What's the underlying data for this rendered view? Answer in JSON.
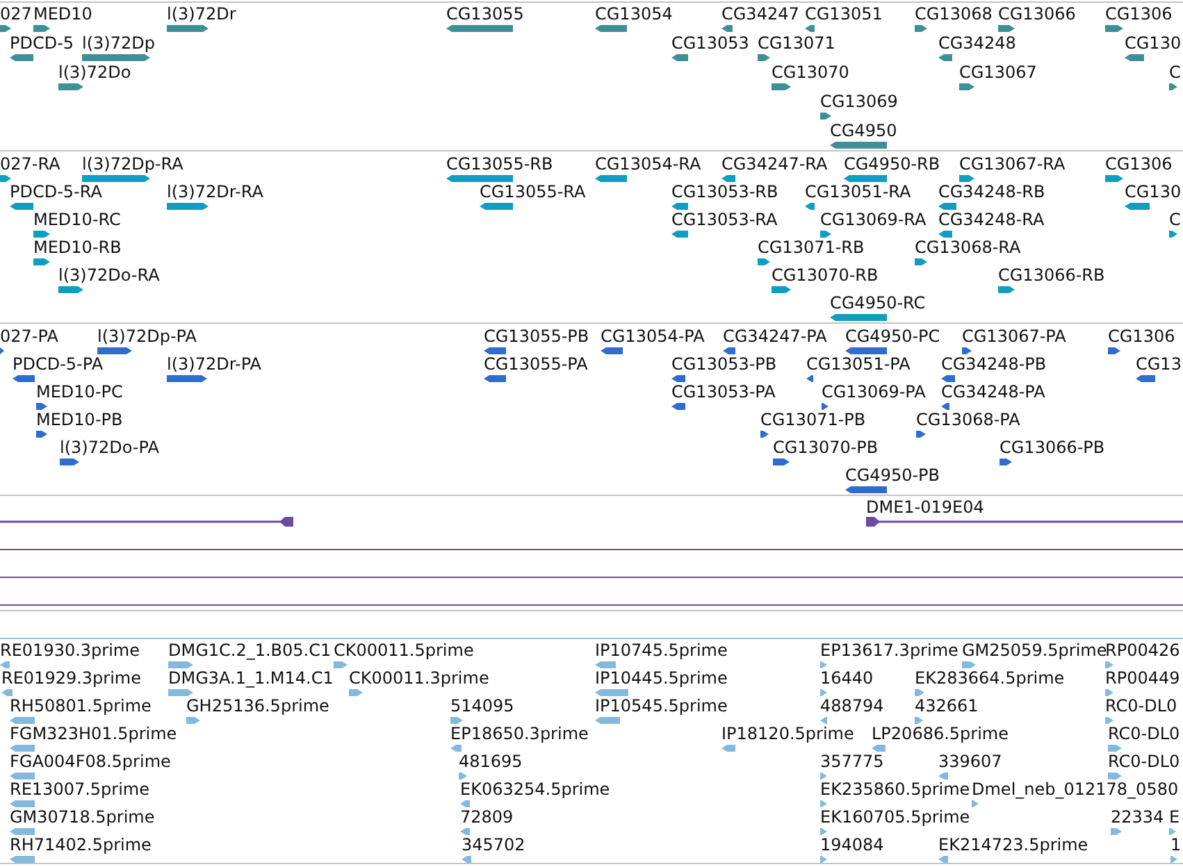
{
  "tracks": [
    {
      "kind": "gene",
      "color": "#3f8f96",
      "features": [
        {
          "label": "027",
          "reverse": false
        },
        {
          "label": "MED10",
          "reverse": false
        },
        {
          "label": "l(3)72Dr",
          "reverse": false
        },
        {
          "label": "CG13055",
          "reverse": true
        },
        {
          "label": "CG13054",
          "reverse": true
        },
        {
          "label": "CG34247",
          "reverse": true
        },
        {
          "label": "CG13051",
          "reverse": true
        },
        {
          "label": "CG13068",
          "reverse": false
        },
        {
          "label": "CG13066",
          "reverse": false
        },
        {
          "label": "CG1306",
          "reverse": false
        },
        {
          "label": "PDCD-5",
          "reverse": true
        },
        {
          "label": "l(3)72Dp",
          "reverse": false
        },
        {
          "label": "CG13053",
          "reverse": true
        },
        {
          "label": "CG13071",
          "reverse": false
        },
        {
          "label": "CG34248",
          "reverse": true
        },
        {
          "label": "CG130",
          "reverse": true
        },
        {
          "label": "l(3)72Do",
          "reverse": false
        },
        {
          "label": "CG13070",
          "reverse": false
        },
        {
          "label": "CG13067",
          "reverse": false
        },
        {
          "label": "C",
          "reverse": false
        },
        {
          "label": "CG13069",
          "reverse": false
        },
        {
          "label": "CG4950",
          "reverse": true
        }
      ]
    },
    {
      "kind": "transcript",
      "color": "#0f9dc0",
      "features": [
        {
          "label": "027-RA",
          "reverse": false
        },
        {
          "label": "l(3)72Dp-RA",
          "reverse": false
        },
        {
          "label": "CG13055-RB",
          "reverse": true
        },
        {
          "label": "CG13054-RA",
          "reverse": true
        },
        {
          "label": "CG34247-RA",
          "reverse": true
        },
        {
          "label": "CG4950-RB",
          "reverse": true
        },
        {
          "label": "CG13067-RA",
          "reverse": false
        },
        {
          "label": "CG1306",
          "reverse": false
        },
        {
          "label": "PDCD-5-RA",
          "reverse": true
        },
        {
          "label": "l(3)72Dr-RA",
          "reverse": false
        },
        {
          "label": "CG13055-RA",
          "reverse": true
        },
        {
          "label": "CG13053-RB",
          "reverse": true
        },
        {
          "label": "CG13051-RA",
          "reverse": true
        },
        {
          "label": "CG34248-RB",
          "reverse": true
        },
        {
          "label": "CG130",
          "reverse": true
        },
        {
          "label": "MED10-RC",
          "reverse": false
        },
        {
          "label": "CG13053-RA",
          "reverse": true
        },
        {
          "label": "CG13069-RA",
          "reverse": false
        },
        {
          "label": "CG34248-RA",
          "reverse": true
        },
        {
          "label": "C",
          "reverse": false
        },
        {
          "label": "MED10-RB",
          "reverse": false
        },
        {
          "label": "CG13071-RB",
          "reverse": false
        },
        {
          "label": "CG13068-RA",
          "reverse": false
        },
        {
          "label": "l(3)72Do-RA",
          "reverse": false
        },
        {
          "label": "CG13070-RB",
          "reverse": false
        },
        {
          "label": "CG13066-RB",
          "reverse": false
        },
        {
          "label": "CG4950-RC",
          "reverse": true
        }
      ]
    },
    {
      "kind": "protein",
      "color": "#2f6ccd",
      "features": [
        {
          "label": "027-PA",
          "reverse": false
        },
        {
          "label": "l(3)72Dp-PA",
          "reverse": false
        },
        {
          "label": "CG13055-PB",
          "reverse": true
        },
        {
          "label": "CG13054-PA",
          "reverse": true
        },
        {
          "label": "CG34247-PA",
          "reverse": true
        },
        {
          "label": "CG4950-PC",
          "reverse": true
        },
        {
          "label": "CG13067-PA",
          "reverse": false
        },
        {
          "label": "CG1306",
          "reverse": false
        },
        {
          "label": "PDCD-5-PA",
          "reverse": true
        },
        {
          "label": "l(3)72Dr-PA",
          "reverse": false
        },
        {
          "label": "CG13055-PA",
          "reverse": true
        },
        {
          "label": "CG13053-PB",
          "reverse": true
        },
        {
          "label": "CG13051-PA",
          "reverse": true
        },
        {
          "label": "CG34248-PB",
          "reverse": true
        },
        {
          "label": "CG13",
          "reverse": true
        },
        {
          "label": "MED10-PC",
          "reverse": false
        },
        {
          "label": "CG13053-PA",
          "reverse": true
        },
        {
          "label": "CG13069-PA",
          "reverse": false
        },
        {
          "label": "CG34248-PA",
          "reverse": true
        },
        {
          "label": "MED10-PB",
          "reverse": false
        },
        {
          "label": "CG13071-PB",
          "reverse": false
        },
        {
          "label": "CG13068-PA",
          "reverse": false
        },
        {
          "label": "l(3)72Do-PA",
          "reverse": false
        },
        {
          "label": "CG13070-PB",
          "reverse": false
        },
        {
          "label": "CG13066-PB",
          "reverse": false
        },
        {
          "label": "CG4950-PB",
          "reverse": true
        }
      ]
    },
    {
      "kind": "clone",
      "color": "#6a4ca0",
      "features": [
        {
          "reverse": true
        },
        {
          "label": "DME1-019E04",
          "reverse": false
        }
      ]
    },
    {
      "kind": "est",
      "color": "#84b9df",
      "features": [
        {
          "label": "RE01930.3prime",
          "reverse": true
        },
        {
          "label": "RE01929.3prime",
          "reverse": true
        },
        {
          "label": "RH50801.5prime",
          "reverse": true
        },
        {
          "label": "FGM323H01.5prime",
          "reverse": true
        },
        {
          "label": "FGA004F08.5prime",
          "reverse": true
        },
        {
          "label": "RE13007.5prime",
          "reverse": true
        },
        {
          "label": "GM30718.5prime",
          "reverse": true
        },
        {
          "label": "RH71402.5prime",
          "reverse": true
        },
        {
          "label": "DMG1C.2_1.B05.C1",
          "reverse": false
        },
        {
          "label": "DMG3A.1_1.M14.C1",
          "reverse": false
        },
        {
          "label": "GH25136.5prime",
          "reverse": false
        },
        {
          "label": "CK00011.5prime",
          "reverse": false
        },
        {
          "label": "CK00011.3prime",
          "reverse": false
        },
        {
          "label": "514095",
          "reverse": false
        },
        {
          "label": "EP18650.3prime",
          "reverse": true
        },
        {
          "label": "481695",
          "reverse": false
        },
        {
          "label": "EK063254.5prime",
          "reverse": true
        },
        {
          "label": "72809",
          "reverse": true
        },
        {
          "label": "345702",
          "reverse": true
        },
        {
          "label": "IP10745.5prime",
          "reverse": true
        },
        {
          "label": "IP10445.5prime",
          "reverse": true
        },
        {
          "label": "IP10545.5prime",
          "reverse": true
        },
        {
          "label": "IP18120.5prime",
          "reverse": true
        },
        {
          "label": "EP13617.3prime",
          "reverse": false
        },
        {
          "label": "16440",
          "reverse": false
        },
        {
          "label": "488794",
          "reverse": true
        },
        {
          "label": "357775",
          "reverse": false
        },
        {
          "label": "EK235860.5prime",
          "reverse": false
        },
        {
          "label": "EK160705.5prime",
          "reverse": false
        },
        {
          "label": "194084",
          "reverse": false
        },
        {
          "label": "GM25059.5prime",
          "reverse": false
        },
        {
          "label": "EK283664.5prime",
          "reverse": false
        },
        {
          "label": "432661",
          "reverse": false
        },
        {
          "label": "LP20686.5prime",
          "reverse": true
        },
        {
          "label": "339607",
          "reverse": true
        },
        {
          "label": "Dmel_neb_012178_0580",
          "reverse": false
        },
        {
          "label": "EK214723.5prime",
          "reverse": true
        },
        {
          "label": "RP00426",
          "reverse": false
        },
        {
          "label": "RP00449",
          "reverse": false
        },
        {
          "label": "RC0-DL0",
          "reverse": false
        },
        {
          "label": "RC0-DL0",
          "reverse": false
        },
        {
          "label": "RC0-DL0",
          "reverse": false
        },
        {
          "label": "22334",
          "reverse": false
        },
        {
          "label": "E",
          "reverse": false
        },
        {
          "label": "1",
          "reverse": false
        }
      ]
    }
  ]
}
